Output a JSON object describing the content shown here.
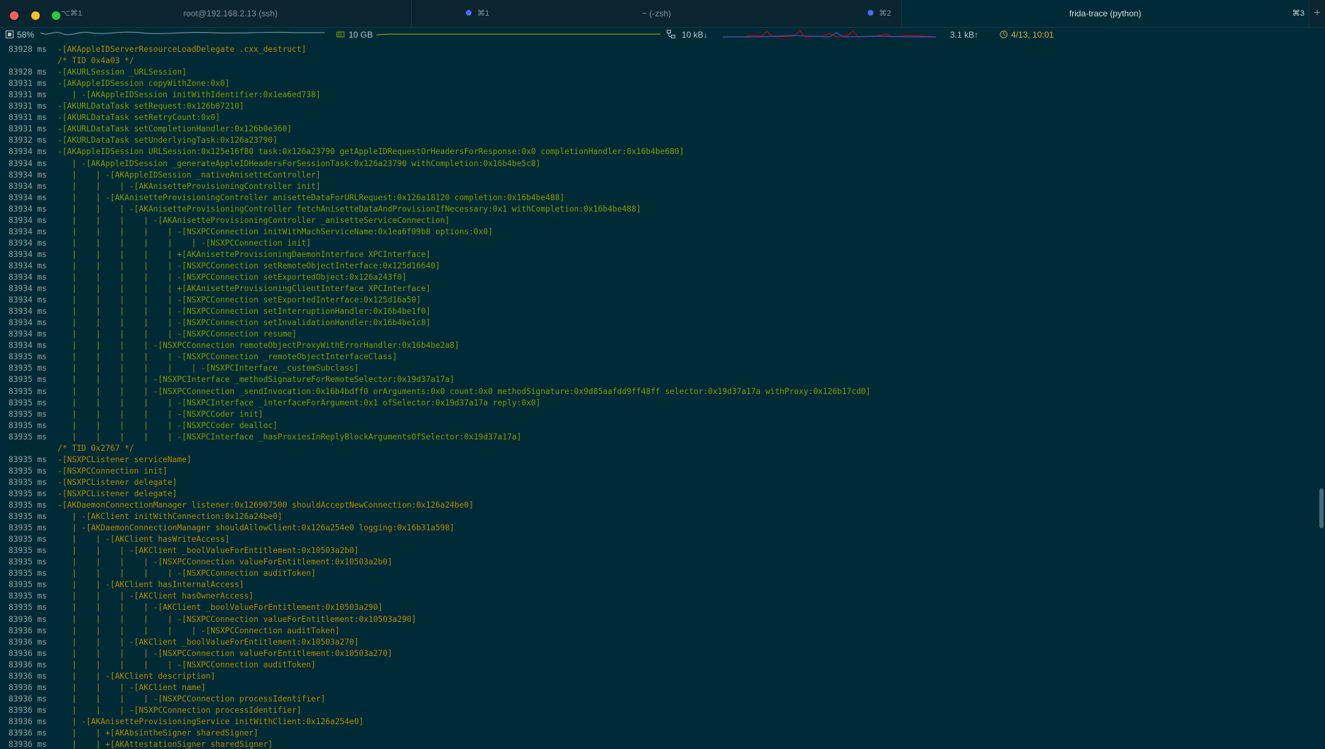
{
  "window": {
    "tabs": [
      {
        "label": "root@192.168.2.13 (ssh)",
        "shortcut": "⌥⌘1",
        "active": false
      },
      {
        "label": "~ (-zsh)",
        "shortcut": "⌘1",
        "active": false,
        "indicator": "#4a6cf0"
      },
      {
        "label": "frida-trace (python)",
        "shortcut": "⌘3",
        "active": true,
        "indicator": "#4a6cf0",
        "indicator_label": "⌘2"
      }
    ],
    "new_tab": "+"
  },
  "status": {
    "cpu": "58%",
    "memory": "10 GB",
    "net_down": "10 kB↓",
    "net_up": "3.1 kB↑",
    "clock": "4/13, 10:01"
  },
  "trace": [
    {
      "ts": "83928 ms",
      "text": "-[AKAppleIDServerResourceLoadDelegate .cxx_destruct]",
      "c": "yellow"
    },
    {
      "ts": "",
      "text": "/* TID 0x4a03 */",
      "c": "comment"
    },
    {
      "ts": "83928 ms",
      "text": "-[AKURLSession _URLSession]",
      "c": "green"
    },
    {
      "ts": "83931 ms",
      "text": "-[AKAppleIDSession copyWithZone:0x0]",
      "c": "green"
    },
    {
      "ts": "83931 ms",
      "text": "   | -[AKAppleIDSession initWithIdentifier:0x1ea6ed738]",
      "c": "green"
    },
    {
      "ts": "83931 ms",
      "text": "-[AKURLDataTask setRequest:0x126b07210]",
      "c": "green"
    },
    {
      "ts": "83931 ms",
      "text": "-[AKURLDataTask setRetryCount:0x0]",
      "c": "green"
    },
    {
      "ts": "83931 ms",
      "text": "-[AKURLDataTask setCompletionHandler:0x126b0e360]",
      "c": "green"
    },
    {
      "ts": "83932 ms",
      "text": "-[AKURLDataTask setUnderlyingTask:0x126a23790]",
      "c": "green"
    },
    {
      "ts": "83934 ms",
      "text": "-[AKAppleIDSession URLSession:0x125e16f80 task:0x126a23790 getAppleIDRequestOrHeadersForResponse:0x0 completionHandler:0x16b4be680]",
      "c": "green"
    },
    {
      "ts": "83934 ms",
      "text": "   | -[AKAppleIDSession _generateAppleIDHeadersForSessionTask:0x126a23790 withCompletion:0x16b4be5c8]",
      "c": "green"
    },
    {
      "ts": "83934 ms",
      "text": "   |    | -[AKAppleIDSession _nativeAnisetteController]",
      "c": "green"
    },
    {
      "ts": "83934 ms",
      "text": "   |    |    | -[AKAnisetteProvisioningController init]",
      "c": "green"
    },
    {
      "ts": "83934 ms",
      "text": "   |    | -[AKAnisetteProvisioningController anisetteDataForURLRequest:0x126a18120 completion:0x16b4be488]",
      "c": "green"
    },
    {
      "ts": "83934 ms",
      "text": "   |    |    | -[AKAnisetteProvisioningController fetchAnisetteDataAndProvisionIfNecessary:0x1 withCompletion:0x16b4be488]",
      "c": "green"
    },
    {
      "ts": "83934 ms",
      "text": "   |    |    |    | -[AKAnisetteProvisioningController _anisetteServiceConnection]",
      "c": "green"
    },
    {
      "ts": "83934 ms",
      "text": "   |    |    |    |    | -[NSXPCConnection initWithMachServiceName:0x1ea6f09b8 options:0x0]",
      "c": "green"
    },
    {
      "ts": "83934 ms",
      "text": "   |    |    |    |    |    | -[NSXPCConnection init]",
      "c": "green"
    },
    {
      "ts": "83934 ms",
      "text": "   |    |    |    |    | +[AKAnisetteProvisioningDaemonInterface XPCInterface]",
      "c": "green"
    },
    {
      "ts": "83934 ms",
      "text": "   |    |    |    |    | -[NSXPCConnection setRemoteObjectInterface:0x125d16640]",
      "c": "green"
    },
    {
      "ts": "83934 ms",
      "text": "   |    |    |    |    | -[NSXPCConnection setExportedObject:0x126a243f0]",
      "c": "green"
    },
    {
      "ts": "83934 ms",
      "text": "   |    |    |    |    | +[AKAnisetteProvisioningClientInterface XPCInterface]",
      "c": "green"
    },
    {
      "ts": "83934 ms",
      "text": "   |    |    |    |    | -[NSXPCConnection setExportedInterface:0x125d16a50]",
      "c": "green"
    },
    {
      "ts": "83934 ms",
      "text": "   |    |    |    |    | -[NSXPCConnection setInterruptionHandler:0x16b4be1f0]",
      "c": "green"
    },
    {
      "ts": "83934 ms",
      "text": "   |    |    |    |    | -[NSXPCConnection setInvalidationHandler:0x16b4be1c8]",
      "c": "green"
    },
    {
      "ts": "83934 ms",
      "text": "   |    |    |    |    | -[NSXPCConnection resume]",
      "c": "green"
    },
    {
      "ts": "83934 ms",
      "text": "   |    |    |    | -[NSXPCConnection remoteObjectProxyWithErrorHandler:0x16b4be2a8]",
      "c": "green"
    },
    {
      "ts": "83935 ms",
      "text": "   |    |    |    |    | -[NSXPCConnection _remoteObjectInterfaceClass]",
      "c": "green"
    },
    {
      "ts": "83935 ms",
      "text": "   |    |    |    |    |    | -[NSXPCInterface _customSubclass]",
      "c": "green"
    },
    {
      "ts": "83935 ms",
      "text": "   |    |    |    | -[NSXPCInterface _methodSignatureForRemoteSelector:0x19d37a17a]",
      "c": "green"
    },
    {
      "ts": "83935 ms",
      "text": "   |    |    |    | -[NSXPCConnection _sendInvocation:0x16b4bdff0 orArguments:0x0 count:0x0 methodSignature:0x9d85aafdd9ff48ff selector:0x19d37a17a withProxy:0x126b17cd0]",
      "c": "green"
    },
    {
      "ts": "83935 ms",
      "text": "   |    |    |    |    | -[NSXPCInterface _interfaceForArgument:0x1 ofSelector:0x19d37a17a reply:0x0]",
      "c": "green"
    },
    {
      "ts": "83935 ms",
      "text": "   |    |    |    |    | -[NSXPCCoder init]",
      "c": "green"
    },
    {
      "ts": "83935 ms",
      "text": "   |    |    |    |    | -[NSXPCCoder dealloc]",
      "c": "green"
    },
    {
      "ts": "83935 ms",
      "text": "   |    |    |    |    | -[NSXPCInterface _hasProxiesInReplyBlockArgumentsOfSelector:0x19d37a17a]",
      "c": "green"
    },
    {
      "ts": "",
      "text": "/* TID 0x2767 */",
      "c": "comment"
    },
    {
      "ts": "83935 ms",
      "text": "-[NSXPCListener serviceName]",
      "c": "yellow"
    },
    {
      "ts": "83935 ms",
      "text": "-[NSXPCConnection init]",
      "c": "yellow"
    },
    {
      "ts": "83935 ms",
      "text": "-[NSXPCListener delegate]",
      "c": "yellow"
    },
    {
      "ts": "83935 ms",
      "text": "-[NSXPCListener delegate]",
      "c": "yellow"
    },
    {
      "ts": "83935 ms",
      "text": "-[AKDaemonConnectionManager listener:0x126907500 shouldAcceptNewConnection:0x126a24be0]",
      "c": "yellow"
    },
    {
      "ts": "83935 ms",
      "text": "   | -[AKClient initWithConnection:0x126a24be0]",
      "c": "yellow"
    },
    {
      "ts": "83935 ms",
      "text": "   | -[AKDaemonConnectionManager shouldAllowClient:0x126a254e0 logging:0x16b31a598]",
      "c": "yellow"
    },
    {
      "ts": "83935 ms",
      "text": "   |    | -[AKClient hasWriteAccess]",
      "c": "yellow"
    },
    {
      "ts": "83935 ms",
      "text": "   |    |    | -[AKClient _boolValueForEntitlement:0x10503a2b0]",
      "c": "yellow"
    },
    {
      "ts": "83935 ms",
      "text": "   |    |    |    | -[NSXPCConnection valueForEntitlement:0x10503a2b0]",
      "c": "yellow"
    },
    {
      "ts": "83935 ms",
      "text": "   |    |    |    |    | -[NSXPCConnection auditToken]",
      "c": "yellow"
    },
    {
      "ts": "83935 ms",
      "text": "   |    | -[AKClient hasInternalAccess]",
      "c": "yellow"
    },
    {
      "ts": "83935 ms",
      "text": "   |    |    | -[AKClient hasOwnerAccess]",
      "c": "yellow"
    },
    {
      "ts": "83935 ms",
      "text": "   |    |    |    | -[AKClient _boolValueForEntitlement:0x10503a290]",
      "c": "yellow"
    },
    {
      "ts": "83936 ms",
      "text": "   |    |    |    |    | -[NSXPCConnection valueForEntitlement:0x10503a290]",
      "c": "yellow"
    },
    {
      "ts": "83936 ms",
      "text": "   |    |    |    |    |    | -[NSXPCConnection auditToken]",
      "c": "yellow"
    },
    {
      "ts": "83936 ms",
      "text": "   |    |    | -[AKClient _boolValueForEntitlement:0x10503a270]",
      "c": "yellow"
    },
    {
      "ts": "83936 ms",
      "text": "   |    |    |    | -[NSXPCConnection valueForEntitlement:0x10503a270]",
      "c": "yellow"
    },
    {
      "ts": "83936 ms",
      "text": "   |    |    |    |    | -[NSXPCConnection auditToken]",
      "c": "yellow"
    },
    {
      "ts": "83936 ms",
      "text": "   |    | -[AKClient description]",
      "c": "yellow"
    },
    {
      "ts": "83936 ms",
      "text": "   |    |    | -[AKClient name]",
      "c": "yellow"
    },
    {
      "ts": "83936 ms",
      "text": "   |    |    |    | -[NSXPCConnection processIdentifier]",
      "c": "yellow"
    },
    {
      "ts": "83936 ms",
      "text": "   |    |    | -[NSXPCConnection processIdentifier]",
      "c": "yellow"
    },
    {
      "ts": "83936 ms",
      "text": "   | -[AKAnisetteProvisioningService initWithClient:0x126a254e0]",
      "c": "yellow"
    },
    {
      "ts": "83936 ms",
      "text": "   |    | +[AKAbsintheSigner sharedSigner]",
      "c": "yellow"
    },
    {
      "ts": "83936 ms",
      "text": "   |    | +[AKAttestationSigner sharedSigner]",
      "c": "yellow"
    }
  ]
}
